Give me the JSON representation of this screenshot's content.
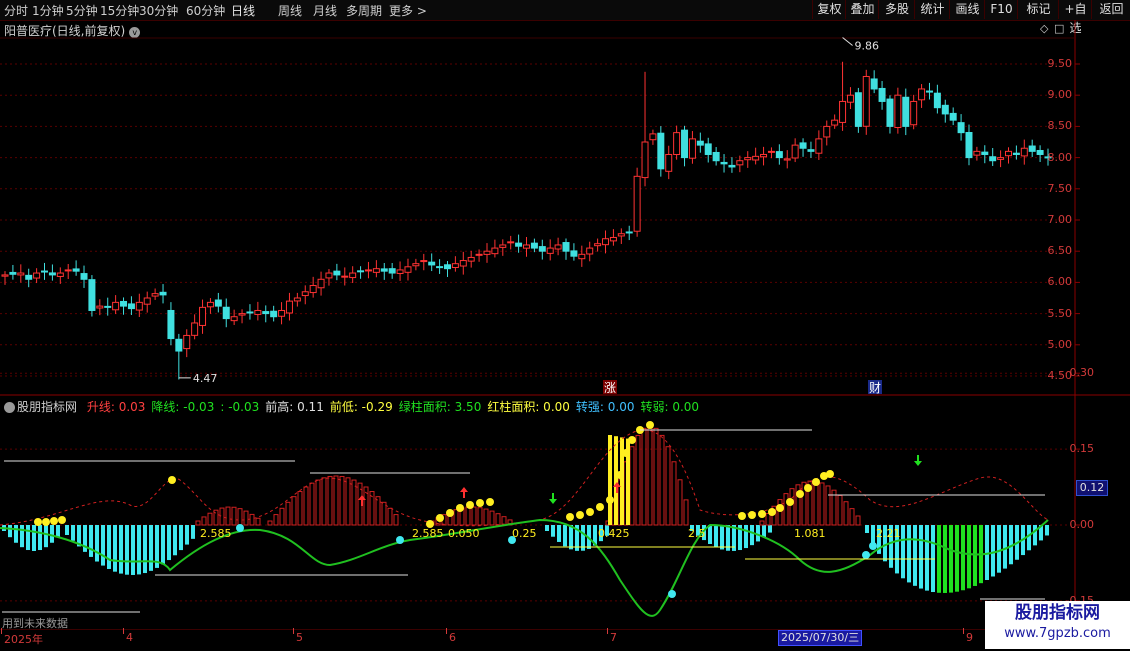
{
  "toolbar": {
    "timeframes": [
      "分时",
      "1分钟",
      "5分钟",
      "15分钟",
      "30分钟",
      "60分钟",
      "日线",
      "周线",
      "月线",
      "多周期",
      "更多 >"
    ],
    "active_timeframe": "日线",
    "buttons": [
      "复权",
      "叠加",
      "多股",
      "统计",
      "画线",
      "F10",
      "+自选",
      "返回"
    ],
    "mark_label": "标记"
  },
  "stock": {
    "title": "阳普医疗(日线,前复权)"
  },
  "price_axis": {
    "labels": [
      "9.50",
      "9.00",
      "8.50",
      "8.00",
      "7.50",
      "7.00",
      "6.50",
      "6.00",
      "5.50",
      "5.00",
      "4.50"
    ]
  },
  "price_markers": {
    "high": "9.86",
    "low": "4.47",
    "zhang": "涨",
    "cai": "财"
  },
  "indicator": {
    "name": "股朋指标网",
    "items": [
      {
        "label": "升线:",
        "value": "0.03",
        "color": "#ff4040"
      },
      {
        "label": "降线:",
        "value": "-0.03",
        "color": "#20e020"
      },
      {
        "label": ":",
        "value": "-0.03",
        "color": "#20e020"
      },
      {
        "label": "前高:",
        "value": "0.11",
        "color": "#e0e0e0"
      },
      {
        "label": "前低:",
        "value": "-0.29",
        "color": "#ffff40"
      },
      {
        "label": "绿柱面积:",
        "value": "3.50",
        "color": "#20e020"
      },
      {
        "label": "红柱面积:",
        "value": "0.00",
        "color": "#ffff40"
      },
      {
        "label": "转强:",
        "value": "0.00",
        "color": "#40c0ff"
      },
      {
        "label": "转弱:",
        "value": "0.00",
        "color": "#20e020"
      }
    ],
    "axis_labels": [
      "0.30",
      "0.15",
      "0.00",
      "-0.15"
    ],
    "current_value": "0.12",
    "annotations": [
      "2.585",
      "2.585",
      "0.050",
      "0.25",
      "0.425",
      "2.5",
      "1.081",
      "2.21"
    ]
  },
  "xaxis": {
    "labels": [
      "2025年",
      "4",
      "5",
      "6",
      "7",
      "9"
    ],
    "cursor_date": "2025/07/30/三"
  },
  "footer": {
    "future_note": "用到未来数据"
  },
  "watermark": {
    "line1": "股朋指标网",
    "line2": "www.7gpzb.com"
  },
  "chart_data": {
    "type": "candlestick",
    "title": "阳普医疗(日线,前复权)",
    "price_high_marker": 9.86,
    "price_low_marker": 4.47,
    "ylim": [
      4.3,
      9.9
    ],
    "closes": [
      6.12,
      6.13,
      6.15,
      6.05,
      6.15,
      6.18,
      6.12,
      6.15,
      6.2,
      6.18,
      6.05,
      5.55,
      5.62,
      5.6,
      5.68,
      5.62,
      5.58,
      5.68,
      5.75,
      5.82,
      5.8,
      5.1,
      4.9,
      5.15,
      5.35,
      5.6,
      5.68,
      5.62,
      5.42,
      5.45,
      5.5,
      5.52,
      5.55,
      5.5,
      5.45,
      5.55,
      5.7,
      5.75,
      5.85,
      5.95,
      6.05,
      6.15,
      6.12,
      6.1,
      6.15,
      6.18,
      6.2,
      6.22,
      6.18,
      6.15,
      6.2,
      6.25,
      6.3,
      6.35,
      6.28,
      6.25,
      6.22,
      6.3,
      6.35,
      6.4,
      6.45,
      6.5,
      6.55,
      6.6,
      6.65,
      6.58,
      6.6,
      6.55,
      6.5,
      6.55,
      6.6,
      6.5,
      6.42,
      6.45,
      6.55,
      6.62,
      6.7,
      6.72,
      6.78,
      6.8,
      7.7,
      8.25,
      8.38,
      7.82,
      8.05,
      8.4,
      8.0,
      8.3,
      8.2,
      8.05,
      7.95,
      7.9,
      7.85,
      7.95,
      8.0,
      8.02,
      8.05,
      8.1,
      8.0,
      7.98,
      8.2,
      8.15,
      8.1,
      8.3,
      8.5,
      8.6,
      8.9,
      9.0,
      8.5,
      9.3,
      9.1,
      8.9,
      8.5,
      9.0,
      8.5,
      8.9,
      9.1,
      9.05,
      8.8,
      8.7,
      8.6,
      8.4,
      8.0,
      8.1,
      8.05,
      7.95,
      8.0,
      8.1,
      8.05,
      8.15,
      8.1,
      8.05,
      8.0
    ]
  }
}
